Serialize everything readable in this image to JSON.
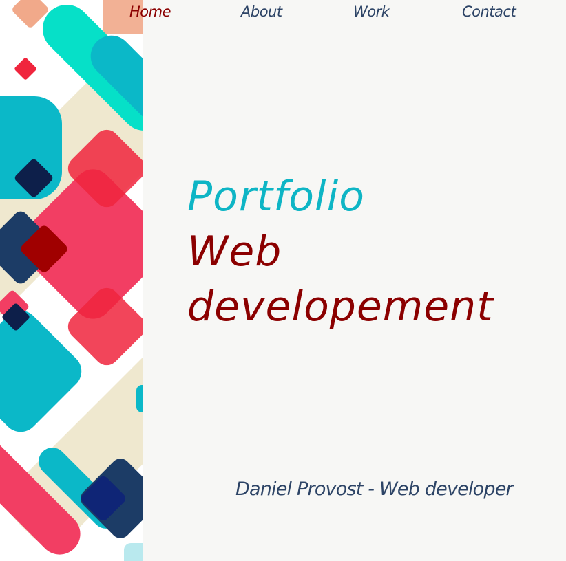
{
  "nav": {
    "items": [
      {
        "label": "Home",
        "active": true
      },
      {
        "label": "About",
        "active": false
      },
      {
        "label": "Work",
        "active": false
      },
      {
        "label": "Contact",
        "active": false
      }
    ]
  },
  "hero": {
    "line1": "Portfolio",
    "line2": "Web",
    "line3": "developement"
  },
  "footer": {
    "byline": "Daniel Provost - Web developer"
  },
  "colors": {
    "background": "#f7f7f5",
    "accent_cyan": "#0eb5c5",
    "accent_red": "#8b0000",
    "nav_text": "#2d4466"
  }
}
